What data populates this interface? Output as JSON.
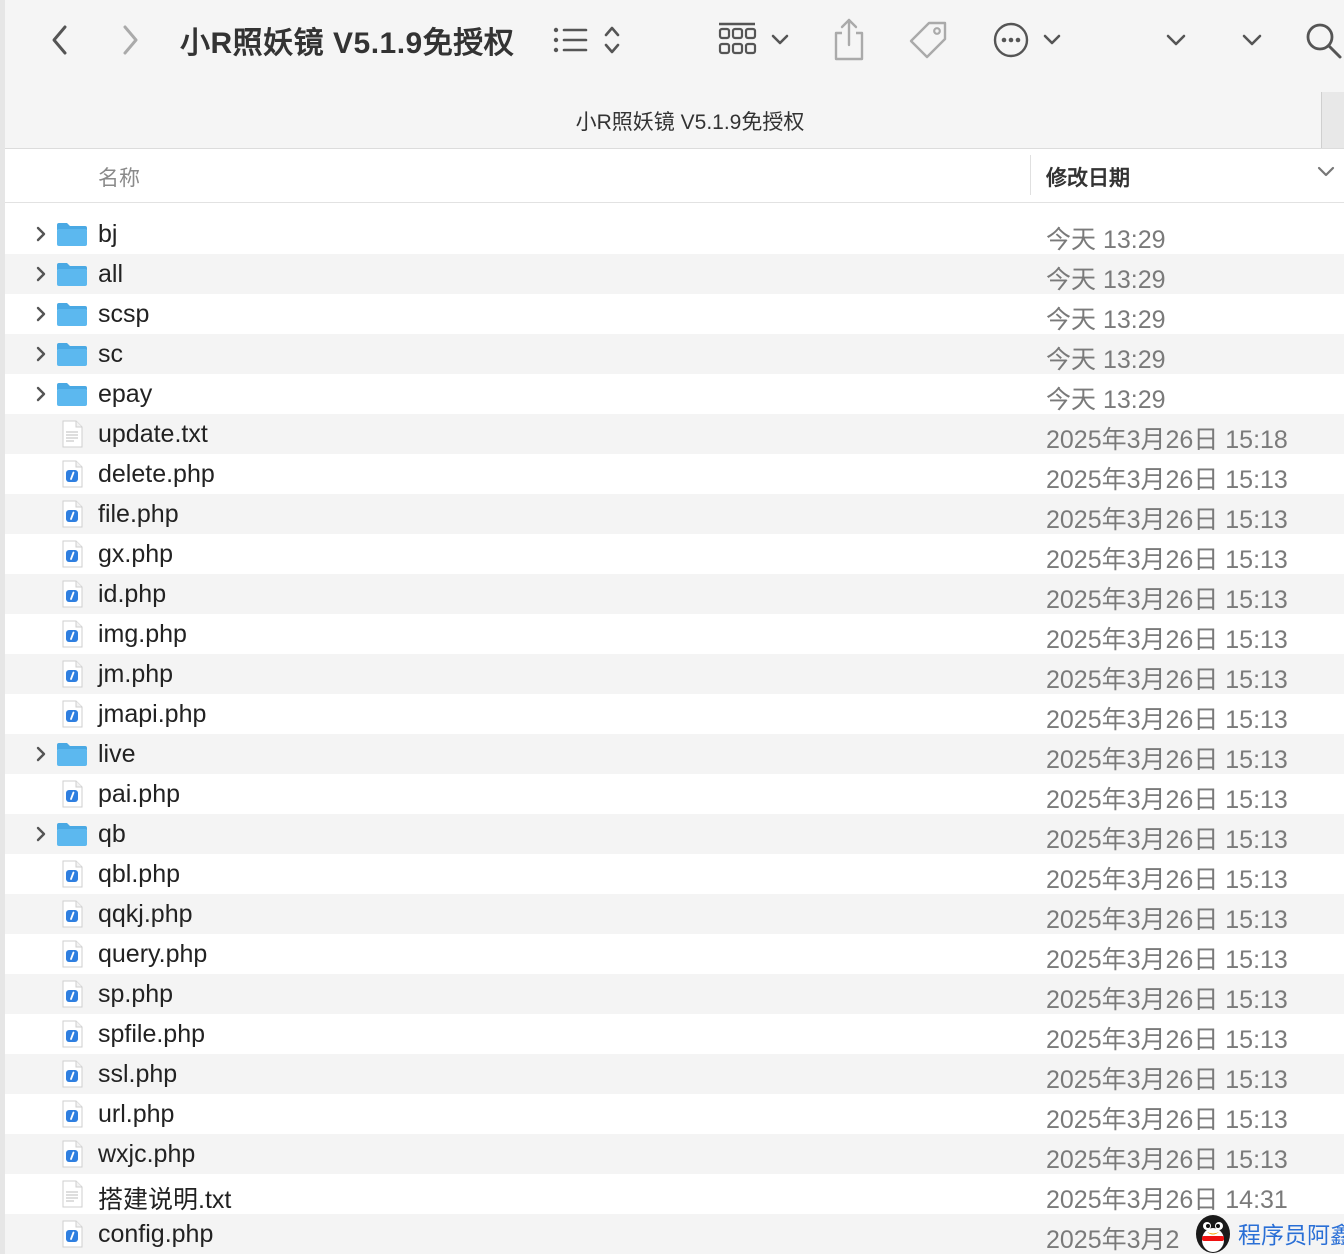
{
  "window": {
    "title": "小R照妖镜 V5.1.9免授权",
    "path_title": "小R照妖镜 V5.1.9免授权"
  },
  "toolbar": {
    "back_icon": "chevron-left-icon",
    "forward_icon": "chevron-right-icon",
    "view_icon": "list-view-icon",
    "group_icon": "grid-group-icon",
    "share_icon": "share-icon",
    "tag_icon": "tag-icon",
    "more_icon": "ellipsis-circle-icon",
    "search_icon": "search-icon"
  },
  "columns": {
    "name": "名称",
    "date": "修改日期"
  },
  "files": [
    {
      "name": "bj",
      "date": "今天 13:29",
      "kind": "folder"
    },
    {
      "name": "all",
      "date": "今天 13:29",
      "kind": "folder"
    },
    {
      "name": "scsp",
      "date": "今天 13:29",
      "kind": "folder"
    },
    {
      "name": "sc",
      "date": "今天 13:29",
      "kind": "folder"
    },
    {
      "name": "epay",
      "date": "今天 13:29",
      "kind": "folder"
    },
    {
      "name": "update.txt",
      "date": "2025年3月26日 15:18",
      "kind": "txt"
    },
    {
      "name": "delete.php",
      "date": "2025年3月26日 15:13",
      "kind": "php"
    },
    {
      "name": "file.php",
      "date": "2025年3月26日 15:13",
      "kind": "php"
    },
    {
      "name": "gx.php",
      "date": "2025年3月26日 15:13",
      "kind": "php"
    },
    {
      "name": "id.php",
      "date": "2025年3月26日 15:13",
      "kind": "php"
    },
    {
      "name": "img.php",
      "date": "2025年3月26日 15:13",
      "kind": "php"
    },
    {
      "name": "jm.php",
      "date": "2025年3月26日 15:13",
      "kind": "php"
    },
    {
      "name": "jmapi.php",
      "date": "2025年3月26日 15:13",
      "kind": "php"
    },
    {
      "name": "live",
      "date": "2025年3月26日 15:13",
      "kind": "folder"
    },
    {
      "name": "pai.php",
      "date": "2025年3月26日 15:13",
      "kind": "php"
    },
    {
      "name": "qb",
      "date": "2025年3月26日 15:13",
      "kind": "folder"
    },
    {
      "name": "qbl.php",
      "date": "2025年3月26日 15:13",
      "kind": "php"
    },
    {
      "name": "qqkj.php",
      "date": "2025年3月26日 15:13",
      "kind": "php"
    },
    {
      "name": "query.php",
      "date": "2025年3月26日 15:13",
      "kind": "php"
    },
    {
      "name": "sp.php",
      "date": "2025年3月26日 15:13",
      "kind": "php"
    },
    {
      "name": "spfile.php",
      "date": "2025年3月26日 15:13",
      "kind": "php"
    },
    {
      "name": "ssl.php",
      "date": "2025年3月26日 15:13",
      "kind": "php"
    },
    {
      "name": "url.php",
      "date": "2025年3月26日 15:13",
      "kind": "php"
    },
    {
      "name": "wxjc.php",
      "date": "2025年3月26日 15:13",
      "kind": "php"
    },
    {
      "name": "搭建说明.txt",
      "date": "2025年3月26日 14:31",
      "kind": "txt"
    },
    {
      "name": "config.php",
      "date": "2025年3月2",
      "kind": "php"
    }
  ],
  "watermark": {
    "text": "程序员阿鑫",
    "icon": "penguin-logo-icon"
  },
  "colors": {
    "folder": "#5cb8ef",
    "php_badge": "#2f7fe0",
    "row_alt": "#f4f4f4"
  }
}
